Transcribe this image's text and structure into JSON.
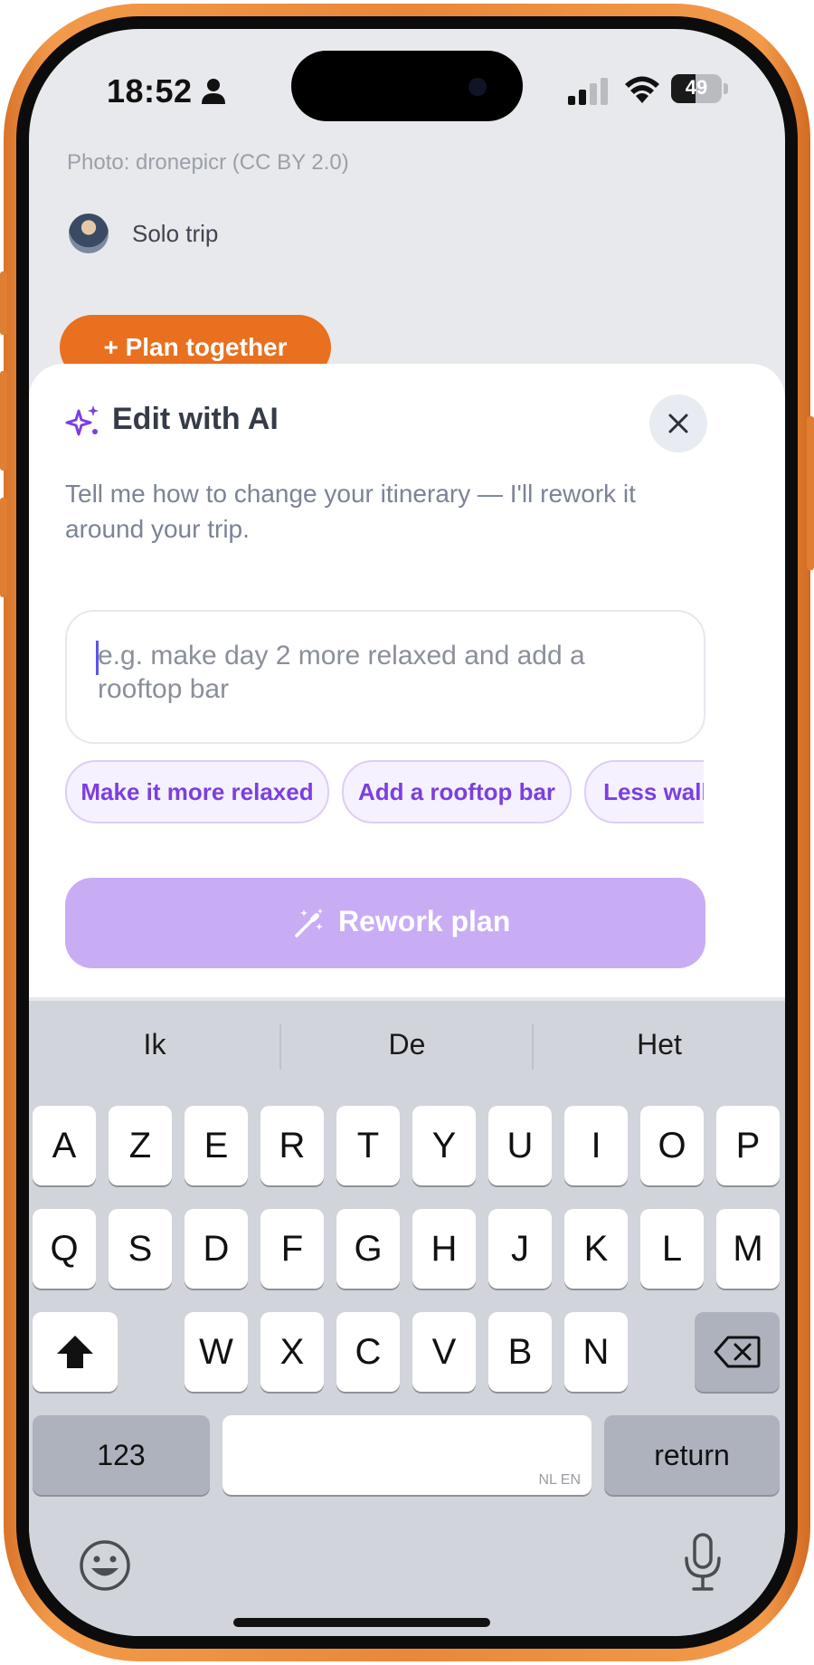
{
  "status_bar": {
    "time": "18:52",
    "battery": "49",
    "icons": [
      "person-icon",
      "signal-icon",
      "wifi-icon",
      "battery-icon"
    ]
  },
  "background": {
    "photo_credit": "Photo: dronepicr (CC BY 2.0)",
    "trip_type": "Solo trip",
    "plan_together_label": "+ Plan together",
    "accent_color": "#e8701f"
  },
  "sheet": {
    "title": "Edit with AI",
    "title_icon": "sparkle-icon",
    "close_icon": "close-icon",
    "subtitle": "Tell me how to change your itinerary — I'll rework it around your trip.",
    "input": {
      "value": "",
      "placeholder": "e.g. make day 2 more relaxed and add a rooftop bar"
    },
    "chips": [
      "Make it more relaxed",
      "Add a rooftop bar",
      "Less walking"
    ],
    "rework_button": {
      "label": "Rework plan",
      "icon": "magic-wand-icon",
      "color": "#c8adf5"
    },
    "accent_color": "#7b3fe0"
  },
  "keyboard": {
    "suggestions": [
      "Ik",
      "De",
      "Het"
    ],
    "rows": [
      [
        "A",
        "Z",
        "E",
        "R",
        "T",
        "Y",
        "U",
        "I",
        "O",
        "P"
      ],
      [
        "Q",
        "S",
        "D",
        "F",
        "G",
        "H",
        "J",
        "K",
        "L",
        "M"
      ],
      [
        "W",
        "X",
        "C",
        "V",
        "B",
        "N"
      ]
    ],
    "numbers_label": "123",
    "return_label": "return",
    "space_hint": "NL EN",
    "icons": [
      "shift-icon",
      "backspace-icon",
      "emoji-icon",
      "microphone-icon"
    ]
  }
}
